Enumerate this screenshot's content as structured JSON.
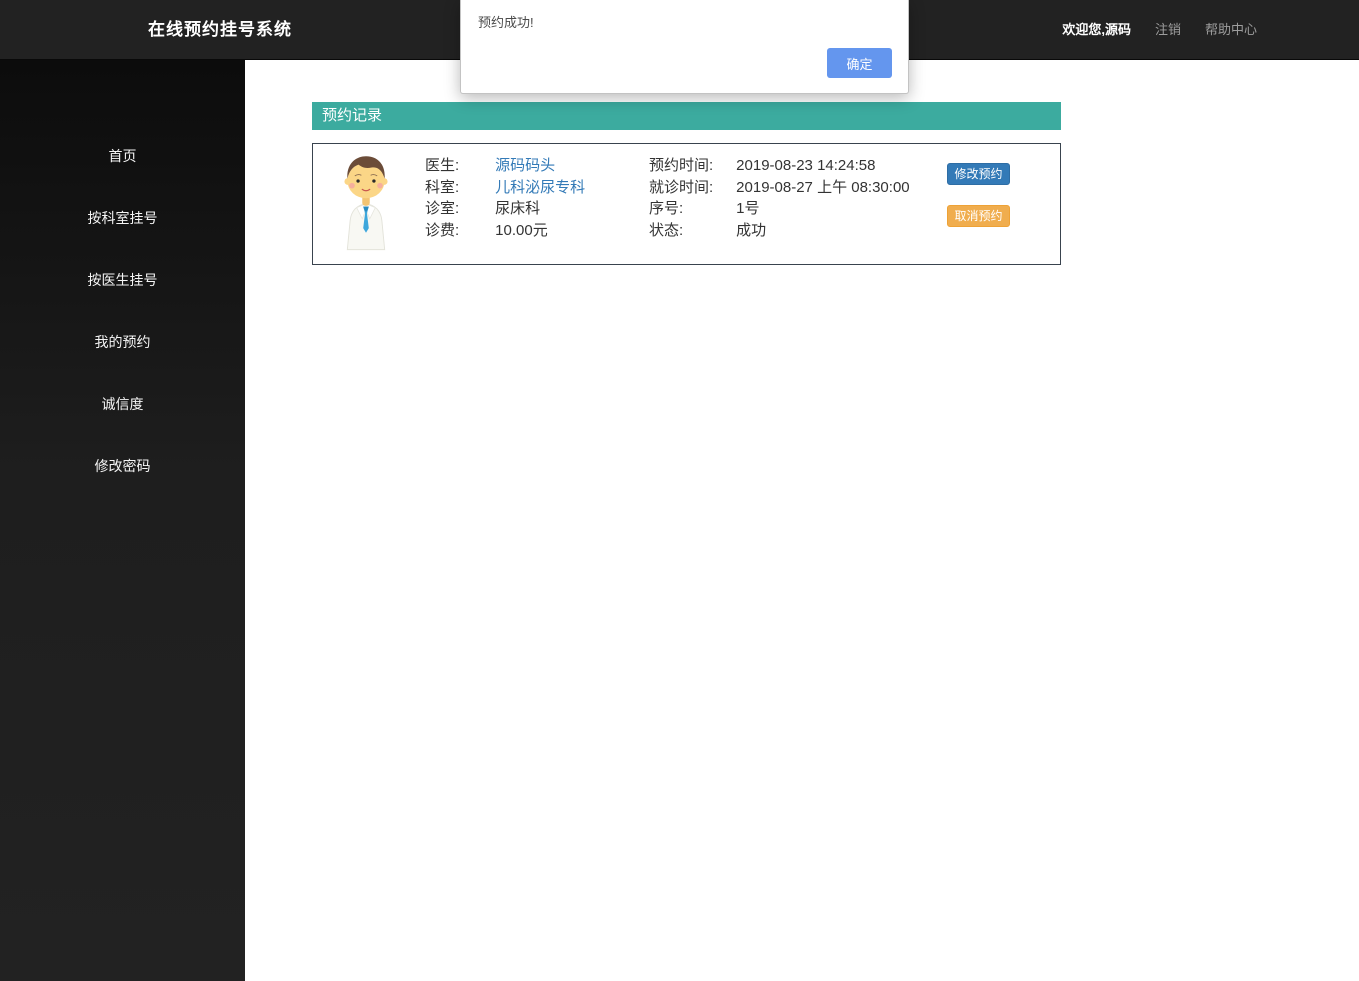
{
  "header": {
    "title": "在线预约挂号系统",
    "welcome": "欢迎您,源码",
    "logout": "注销",
    "help": "帮助中心"
  },
  "dialog": {
    "message": "预约成功!",
    "confirm_label": "确定"
  },
  "sidebar": {
    "items": [
      {
        "label": "首页"
      },
      {
        "label": "按科室挂号"
      },
      {
        "label": "按医生挂号"
      },
      {
        "label": "我的预约"
      },
      {
        "label": "诚信度"
      },
      {
        "label": "修改密码"
      }
    ]
  },
  "main": {
    "panel_title": "预约记录",
    "record": {
      "left_rows": [
        {
          "label": "医生:",
          "value": "源码码头"
        },
        {
          "label": "科室:",
          "value": "儿科泌尿专科"
        },
        {
          "label": "诊室:",
          "value": "尿床科"
        },
        {
          "label": "诊费:",
          "value": "10.00元"
        }
      ],
      "right_rows": [
        {
          "label": "预约时间:",
          "value": "2019-08-23 14:24:58"
        },
        {
          "label": "就诊时间:",
          "value": "2019-08-27 上午 08:30:00"
        },
        {
          "label": "序号:",
          "value": "1号"
        },
        {
          "label": "状态:",
          "value": "成功"
        }
      ],
      "modify_label": "修改预约",
      "cancel_label": "取消预约"
    }
  },
  "colors": {
    "header_bg": "#222222",
    "sidebar_bg": "#1e1e1e",
    "panel_teal": "#3cab9f",
    "card_border": "#39434e",
    "link_blue": "#337ab7",
    "modify_btn": "#337ab7",
    "cancel_btn": "#f0ad4e",
    "dialog_btn": "#6496ee"
  }
}
